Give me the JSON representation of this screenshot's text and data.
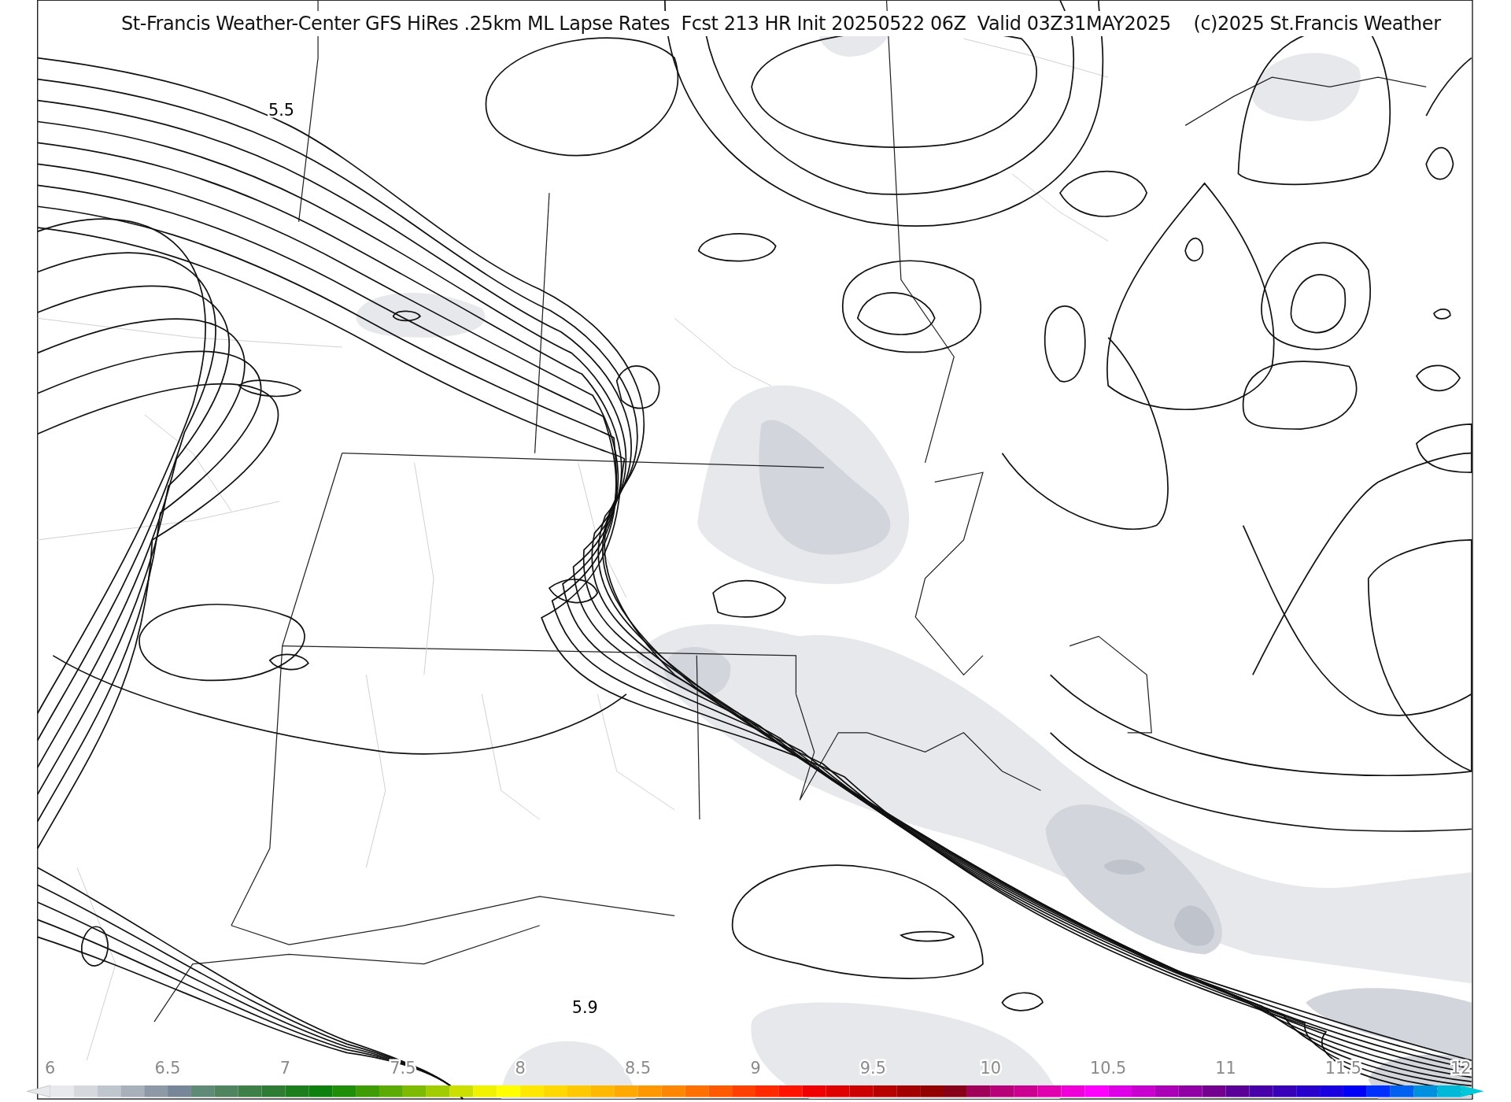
{
  "title": "St-Francis Weather-Center GFS HiRes .25km ML Lapse Rates  Fcst 213 HR Init 20250522 06Z  Valid 03Z31MAY2025    (c)2025 St.Francis Weather",
  "contour_labels": [
    "5.5",
    "5.9"
  ],
  "colorbar": {
    "ticks": [
      "6",
      "6.5",
      "7",
      "7.5",
      "8",
      "8.5",
      "9",
      "9.5",
      "10",
      "10.5",
      "11",
      "11.5",
      "12"
    ],
    "segments": [
      {
        "color": "#e8e9ed"
      },
      {
        "color": "#d5d9de"
      },
      {
        "color": "#c0c6ce"
      },
      {
        "color": "#a8b0bb"
      },
      {
        "color": "#8e99a8"
      },
      {
        "color": "#778698"
      },
      {
        "color": "#5f8a78"
      },
      {
        "color": "#4f845e"
      },
      {
        "color": "#3f7f48"
      },
      {
        "color": "#2e7b33"
      },
      {
        "color": "#1d7e1d"
      },
      {
        "color": "#0d800d"
      },
      {
        "color": "#1f8e08"
      },
      {
        "color": "#3e9c05"
      },
      {
        "color": "#5cab04"
      },
      {
        "color": "#7cbb02"
      },
      {
        "color": "#a0cc00"
      },
      {
        "color": "#cbe000"
      },
      {
        "color": "#f0f200"
      },
      {
        "color": "#ffff00"
      },
      {
        "color": "#ffe800"
      },
      {
        "color": "#ffd800"
      },
      {
        "color": "#ffc800"
      },
      {
        "color": "#ffb800"
      },
      {
        "color": "#ffa800"
      },
      {
        "color": "#ff9800"
      },
      {
        "color": "#ff8600"
      },
      {
        "color": "#ff7000"
      },
      {
        "color": "#ff5a00"
      },
      {
        "color": "#ff4000"
      },
      {
        "color": "#ff2a00"
      },
      {
        "color": "#ff1400"
      },
      {
        "color": "#f00000"
      },
      {
        "color": "#e00000"
      },
      {
        "color": "#cc0000"
      },
      {
        "color": "#b80000"
      },
      {
        "color": "#a40000"
      },
      {
        "color": "#920000"
      },
      {
        "color": "#880018"
      },
      {
        "color": "#a0005a"
      },
      {
        "color": "#b80078"
      },
      {
        "color": "#cc0090"
      },
      {
        "color": "#e000b0"
      },
      {
        "color": "#f000d8"
      },
      {
        "color": "#ff00ff"
      },
      {
        "color": "#e000e8"
      },
      {
        "color": "#c800d0"
      },
      {
        "color": "#ac00b8"
      },
      {
        "color": "#9000a4"
      },
      {
        "color": "#740090"
      },
      {
        "color": "#5a0098"
      },
      {
        "color": "#4800a8"
      },
      {
        "color": "#3800b8"
      },
      {
        "color": "#2800cc"
      },
      {
        "color": "#1800e0"
      },
      {
        "color": "#0000f8"
      },
      {
        "color": "#0030ff"
      },
      {
        "color": "#0060f0"
      },
      {
        "color": "#0090e0"
      },
      {
        "color": "#00b8d8"
      }
    ]
  }
}
